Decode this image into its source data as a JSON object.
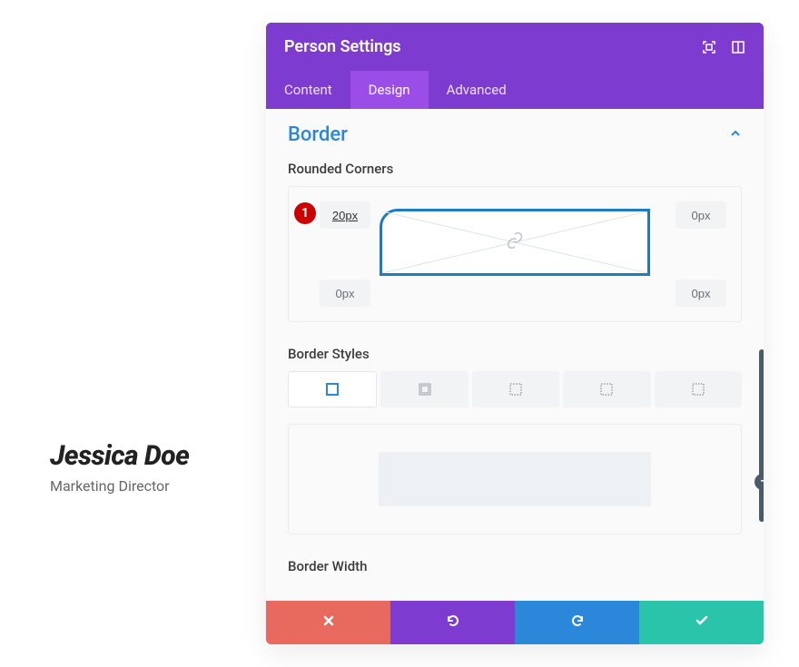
{
  "person": {
    "name": "Jessica Doe",
    "role": "Marketing Director"
  },
  "panel": {
    "title": "Person Settings",
    "tabs": [
      "Content",
      "Design",
      "Advanced"
    ],
    "active_tab": 1,
    "section": {
      "title": "Border",
      "rounded_corners_label": "Rounded Corners",
      "corners": {
        "tl": "20px",
        "tr": "0px",
        "bl": "0px",
        "br": "0px"
      },
      "annotation_badge": "1",
      "border_styles_label": "Border Styles",
      "border_styles": [
        "solid",
        "double",
        "dotted-top",
        "dotted-bottom",
        "dotted-all"
      ],
      "active_style": 0,
      "border_width_label": "Border Width"
    }
  },
  "colors": {
    "brand_purple": "#7e3bd0",
    "accent_blue": "#2b87da",
    "danger_red": "#e86a5f",
    "success_green": "#29c4a9"
  }
}
